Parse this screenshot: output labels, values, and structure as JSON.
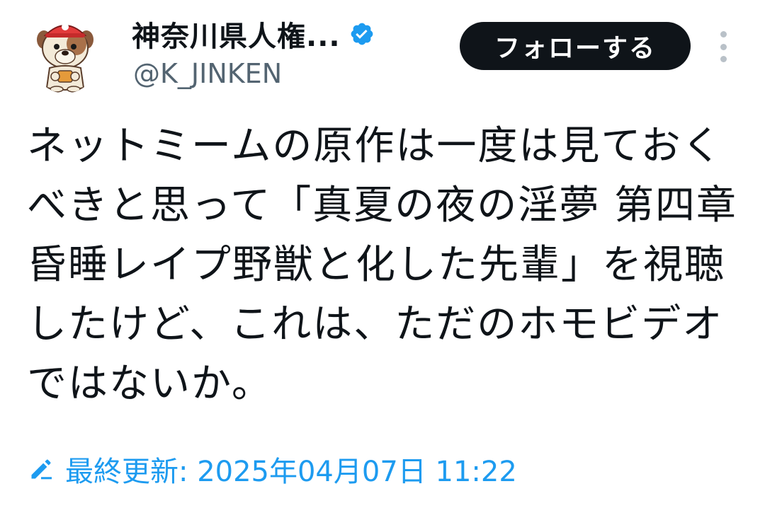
{
  "user": {
    "display_name": "神奈川県人権...",
    "handle": "@K_JINKEN",
    "verified": true,
    "avatar_icon": "bulldog-mascot-avatar"
  },
  "actions": {
    "follow_label": "フォローする",
    "more_icon": "more-vertical-icon"
  },
  "tweet": {
    "text": "ネットミームの原作は一度は見ておくべきと思って「真夏の夜の淫夢 第四章 昏睡レイプ野獣と化した先輩」を視聴したけど、これは、ただのホモビデオではないか。"
  },
  "edited": {
    "icon": "pencil-icon",
    "label": "最終更新: 2025年04月07日 11:22"
  },
  "colors": {
    "text": "#0f1419",
    "secondary": "#536471",
    "accent": "#1d9bf0",
    "button_bg": "#0f1419",
    "button_text": "#ffffff"
  }
}
